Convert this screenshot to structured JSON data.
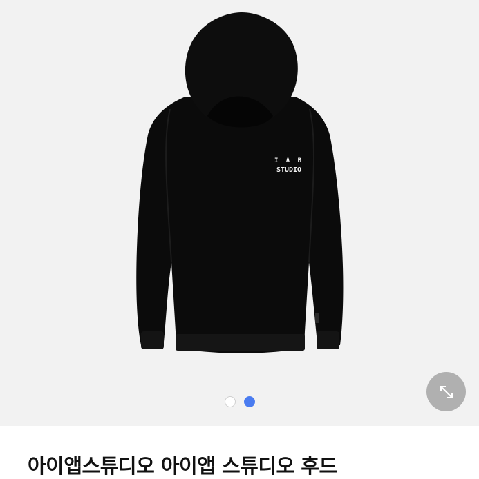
{
  "product": {
    "title": "아이앱스튜디오 아이앱 스튜디오 후드",
    "logo_text_line1": "I A B",
    "logo_text_line2": "STUDIO"
  },
  "gallery": {
    "current_index": 2,
    "total": 2,
    "dots": [
      {
        "state": "inactive",
        "color": "#ffffff"
      },
      {
        "state": "active",
        "color": "#4a7cf0"
      }
    ],
    "expand_icon": "expand-arrows-icon",
    "background_color": "#f2f2f2"
  }
}
